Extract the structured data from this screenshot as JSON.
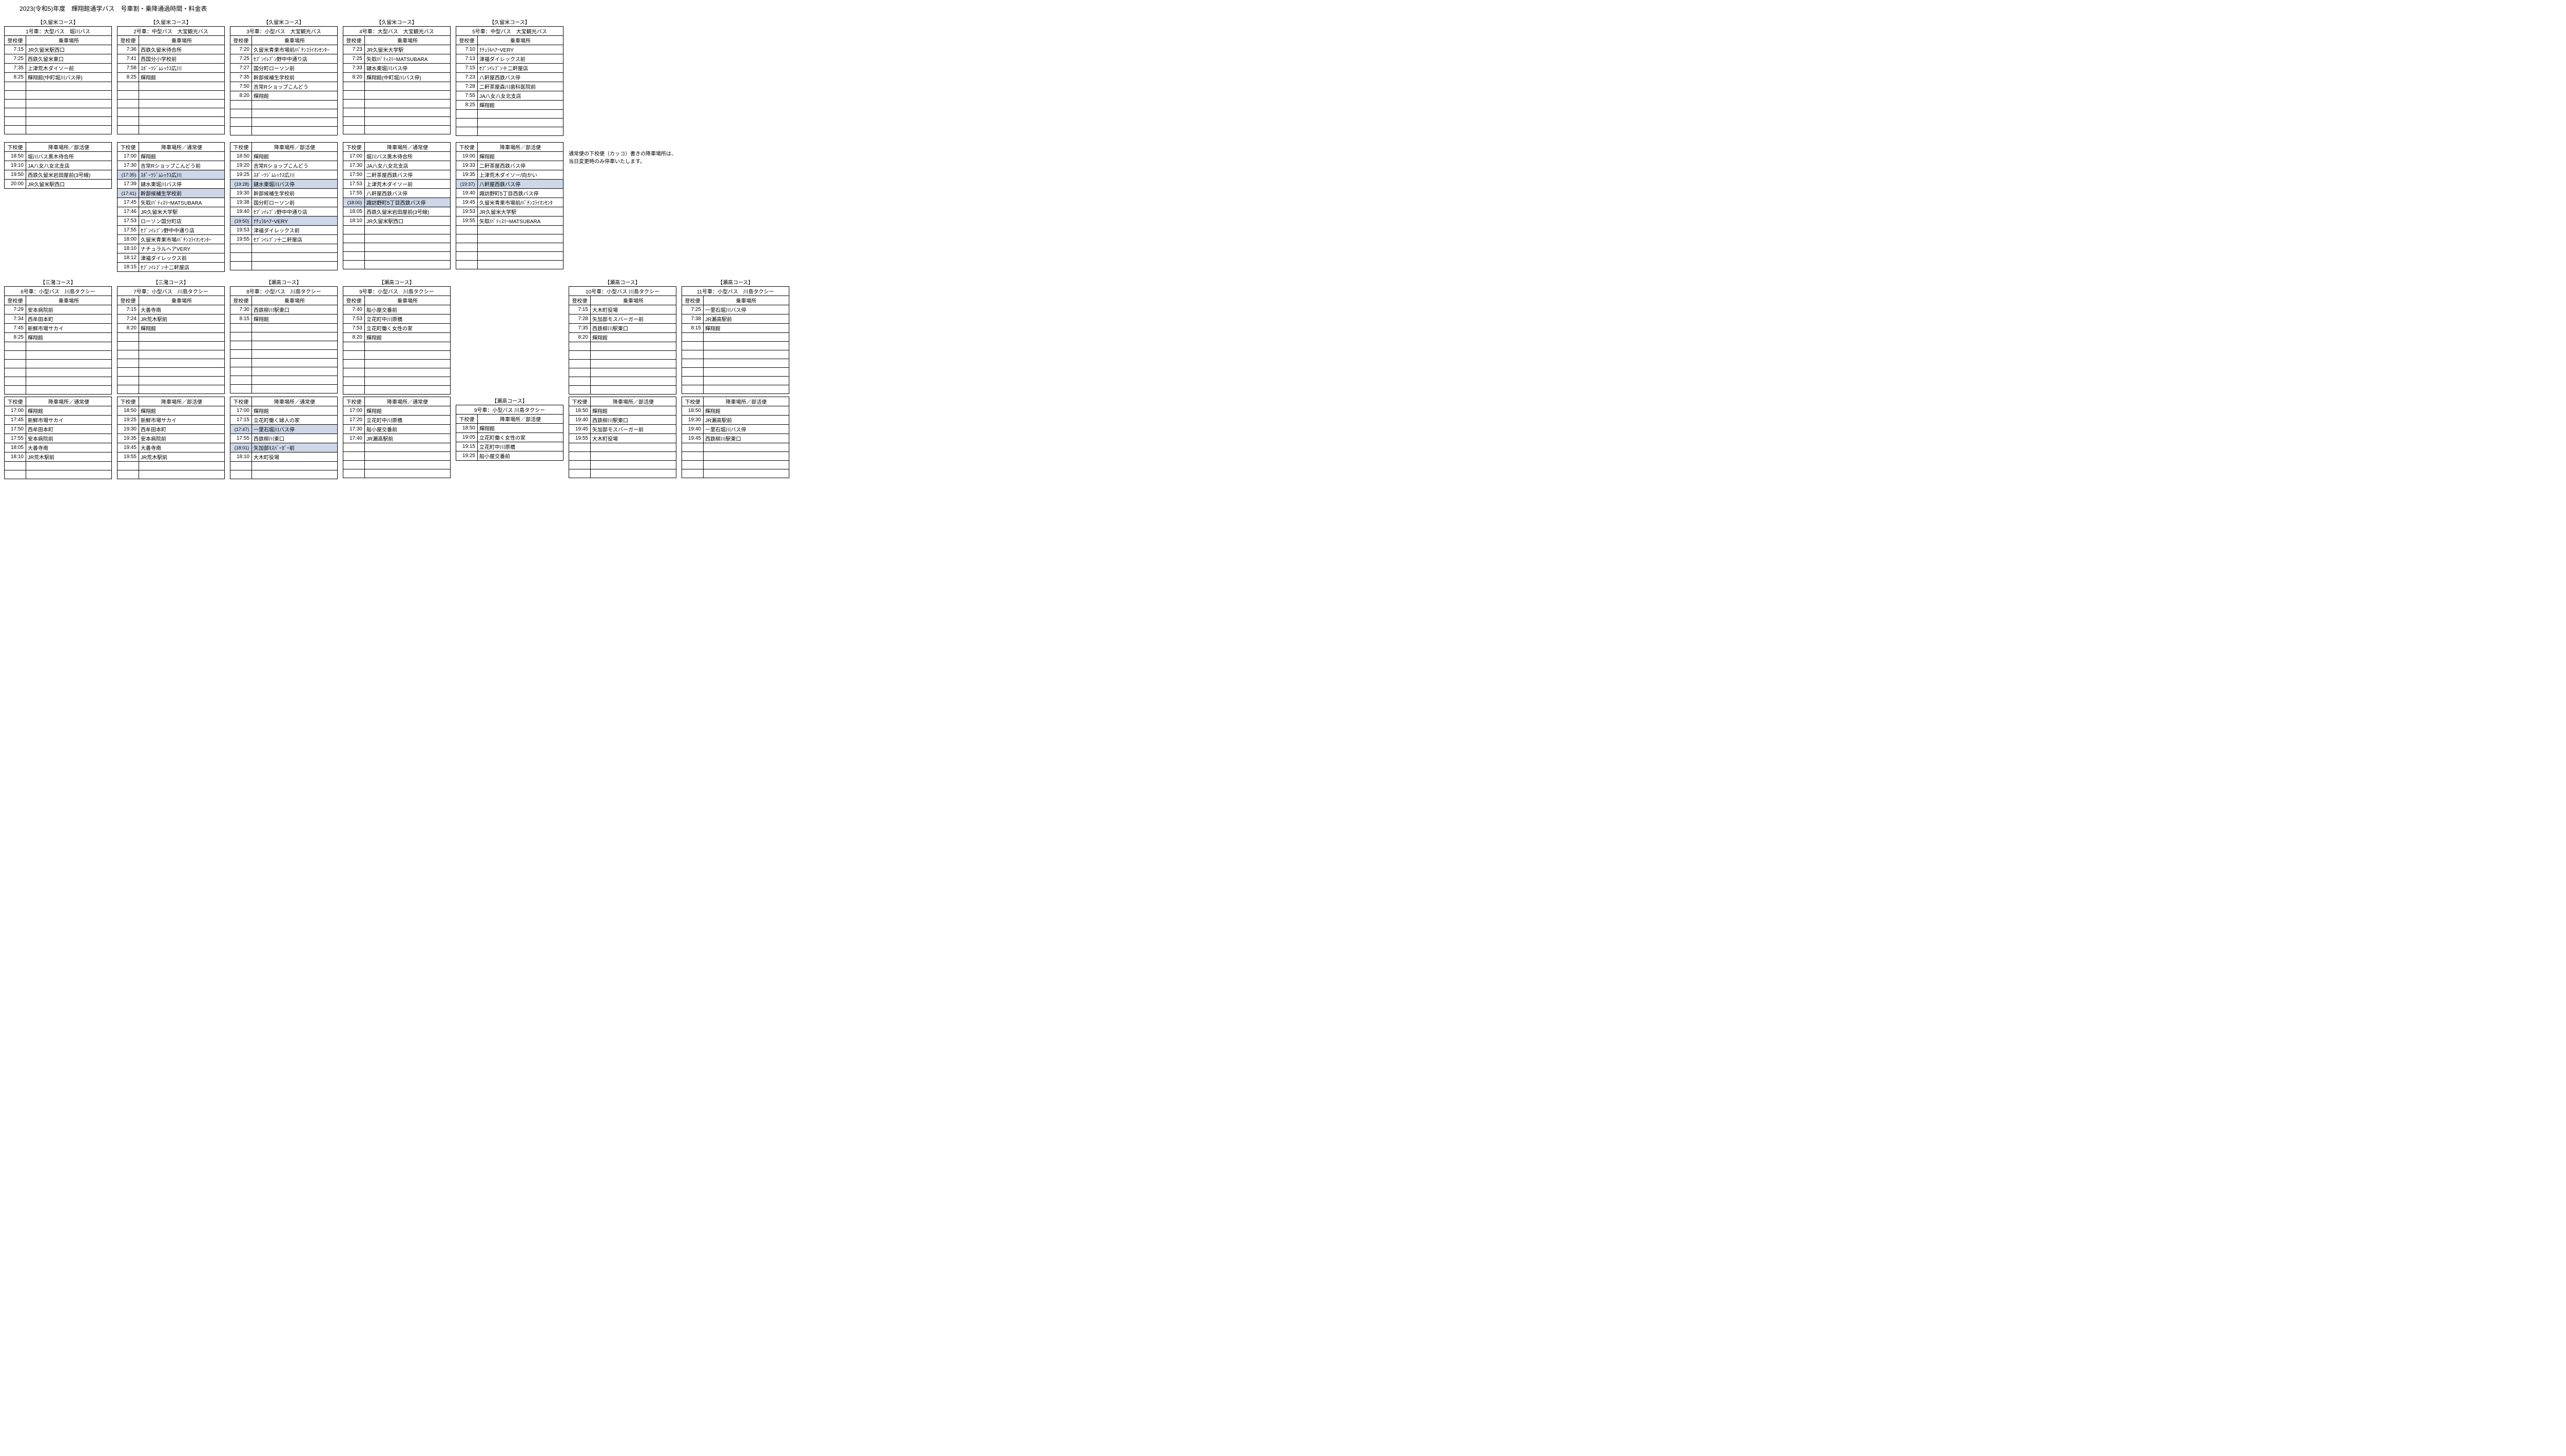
{
  "title": "2023(令和5)年度　輝翔館通学バス　号車割・乗降通過時間・料金表",
  "labels": {
    "boarding_service": "登校便",
    "boarding_place": "乗車場所",
    "alighting_service": "下校便",
    "alighting_normal": "降車場所／通常便",
    "alighting_club": "降車場所／部活便"
  },
  "notes": [
    "通常便の下校便（カッコ）書きの降車場所は、",
    "当日変更時のみ停車いたします。"
  ],
  "row1": [
    {
      "course": "【久留米コース】",
      "bus": "1号車：大型バス　堀川バス",
      "rows": [
        [
          "7:15",
          "JR久留米駅西口"
        ],
        [
          "7:25",
          "西鉄久留米東口"
        ],
        [
          "7:35",
          "上津荒木ダイソー前"
        ],
        [
          "8:25",
          "輝翔館(中町堀川バス停)"
        ]
      ],
      "min": 10
    },
    {
      "course": "【久留米コース】",
      "bus": "2号車：中型バス　大宝観光バス",
      "rows": [
        [
          "7:36",
          "西鉄久留米待合所"
        ],
        [
          "7:41",
          "西国分小学校前"
        ],
        [
          "7:58",
          "ｽﾎﾟｰﾂｼﾞﾑﾚｯｸｽ広川"
        ],
        [
          "8:25",
          "輝翔館"
        ]
      ],
      "min": 10
    },
    {
      "course": "【久留米コース】",
      "bus": "3号車：小型バス　大宝観光バス",
      "rows": [
        [
          "7:20",
          "久留米青果市場前/ﾊﾟﾁﾝｺﾗｲｵﾝｾﾝﾀｰ"
        ],
        [
          "7:25",
          "ｾﾌﾞﾝｲﾚﾌﾞﾝ野中中通り店"
        ],
        [
          "7:27",
          "国分町ローソン前"
        ],
        [
          "7:35",
          "幹部候補生学校前"
        ],
        [
          "7:50",
          "吉常Rショップこんどう"
        ],
        [
          "8:20",
          "輝翔館"
        ]
      ],
      "min": 10
    },
    {
      "course": "【久留米コース】",
      "bus": "4号車：大型バス　大宝観光バス",
      "rows": [
        [
          "7:23",
          "JR久留米大学駅"
        ],
        [
          "7:25",
          "矢取/ﾊﾟﾃｨｽﾘｰMATSUBARA"
        ],
        [
          "7:33",
          "鑓水東堀川バス停"
        ],
        [
          "8:20",
          "輝翔館(中町堀川バス停)"
        ]
      ],
      "min": 10
    },
    {
      "course": "【久留米コース】",
      "bus": "5号車：中型バス　大宝観光バス",
      "rows": [
        [
          "7:10",
          "ﾅﾁｭﾗﾙﾍｱｰVERY"
        ],
        [
          "7:13",
          "津福ダイレックス前"
        ],
        [
          "7:15",
          "ｾﾌﾞﾝｲﾚﾌﾞﾝ十二軒屋店"
        ],
        [
          "7:23",
          "八軒屋西鉄バス停"
        ],
        [
          "7:28",
          "二軒茶屋森川歯科医院前"
        ],
        [
          "7:55",
          "JA八女八女北支店"
        ],
        [
          "8:25",
          "輝翔館"
        ]
      ],
      "min": 10
    }
  ],
  "row2": [
    {
      "header_place": "alighting_club",
      "rows": [
        [
          "18:50",
          "堀川バス黒木待合所"
        ],
        [
          "19:10",
          "JA八女八女北支店"
        ],
        [
          "19:50",
          "西鉄久留米岩田屋前(3号線)"
        ],
        [
          "20:00",
          "JR久留米駅西口"
        ]
      ],
      "min": 4
    },
    {
      "header_place": "alighting_normal",
      "rows": [
        [
          "17:00",
          "輝翔館"
        ],
        [
          "17:30",
          "吉常Rショップこんどう前"
        ],
        [
          "(17:35)",
          "ｽﾎﾟｰﾂｼﾞﾑﾚｯｸｽ広川",
          "hl"
        ],
        [
          "17:39",
          "鑓水東堀川バス停"
        ],
        [
          "(17:41)",
          "幹部候補生学校前",
          "hl"
        ],
        [
          "17:45",
          "矢取/ﾊﾟﾃｨｽﾘｰMATSUBARA"
        ],
        [
          "17:46",
          "JR久留米大学駅"
        ],
        [
          "17:53",
          "ローソン国分町店"
        ],
        [
          "17:55",
          "ｾﾌﾞﾝｲﾚﾌﾞﾝ野中中通り店"
        ],
        [
          "18:00",
          "久留米青果市場/ﾊﾟﾁﾝｺﾗｲｵﾝｾﾝﾀｰ"
        ],
        [
          "18:10",
          "ナチュラルヘアVERY"
        ],
        [
          "18:12",
          "津福ダイレックス前"
        ],
        [
          "18:15",
          "ｾﾌﾞﾝｲﾚﾌﾞﾝ十二軒屋店"
        ]
      ],
      "min": 13
    },
    {
      "header_place": "alighting_club",
      "rows": [
        [
          "18:50",
          "輝翔館"
        ],
        [
          "19:20",
          "吉常Rショップこんどう"
        ],
        [
          "19:25",
          "ｽﾎﾟｰﾂｼﾞﾑﾚｯｸｽ広川"
        ],
        [
          "(19:28)",
          "鑓水東堀川バス停",
          "hl"
        ],
        [
          "19:30",
          "幹部候補生学校前"
        ],
        [
          "19:38",
          "国分町ローソン前"
        ],
        [
          "19:40",
          "ｾﾌﾞﾝｲﾚﾌﾞﾝ野中中通り店"
        ],
        [
          "(19:50)",
          "ﾅﾁｭﾗﾙﾍｱｰVERY",
          "hl"
        ],
        [
          "19:53",
          "津福ダイレックス前"
        ],
        [
          "19:55",
          "ｾﾌﾞﾝｲﾚﾌﾞﾝ十二軒屋店"
        ]
      ],
      "min": 13
    },
    {
      "header_place": "alighting_normal",
      "rows": [
        [
          "17:00",
          "堀川バス黒木待合所"
        ],
        [
          "17:30",
          "JA八女八女北支店"
        ],
        [
          "17:50",
          "二軒茶屋西鉄バス停"
        ],
        [
          "17:53",
          "上津荒木ダイソー前"
        ],
        [
          "17:55",
          "八軒屋西鉄バス停"
        ],
        [
          "(18:00)",
          "諏訪野町5丁目西鉄バス停",
          "hl"
        ],
        [
          "18:05",
          "西鉄久留米岩田屋前(3号線)"
        ],
        [
          "18:10",
          "JR久留米駅西口"
        ]
      ],
      "min": 13
    },
    {
      "header_place": "alighting_club",
      "rows": [
        [
          "19:00",
          "輝翔館"
        ],
        [
          "19:33",
          "二軒茶屋西鉄バス停"
        ],
        [
          "19:35",
          "上津荒木ダイソー/向かい"
        ],
        [
          "(19:37)",
          "八軒屋西鉄バス停",
          "hl"
        ],
        [
          "19:40",
          "諏訪野町5丁目西鉄バス停"
        ],
        [
          "19:45",
          "久留米青果市場前/ﾊﾟﾁﾝｺﾗｲｵﾝｾﾝﾀ"
        ],
        [
          "19:53",
          "JR久留米大学駅"
        ],
        [
          "19:55",
          "矢取/ﾊﾟﾃｨｽﾘｰMATSUBARA"
        ]
      ],
      "min": 13
    },
    {
      "note": true
    }
  ],
  "row3": [
    {
      "course": "【三潴コース】",
      "bus": "6号車：小型バス　川島タクシー",
      "rows": [
        [
          "7:29",
          "安本病院前"
        ],
        [
          "7:34",
          "西牟田本町"
        ],
        [
          "7:45",
          "新鮮市場サカイ"
        ],
        [
          "8:25",
          "輝翔館"
        ]
      ],
      "min": 10
    },
    {
      "course": "【三潴コース】",
      "bus": "7号車：小型バス　川島タクシー",
      "rows": [
        [
          "7:15",
          "大善寺南"
        ],
        [
          "7:24",
          "JR荒木駅前"
        ],
        [
          "8:20",
          "輝翔館"
        ]
      ],
      "min": 10
    },
    {
      "course": "【瀬高コース】",
      "bus": "8号車：小型バス　川島タクシー",
      "rows": [
        [
          "7:30",
          "西鉄柳川駅東口"
        ],
        [
          "8:15",
          "輝翔館"
        ]
      ],
      "min": 10
    },
    {
      "course": "【瀬高コース】",
      "bus": "9号車：小型バス　川島タクシー",
      "rows": [
        [
          "7:40",
          "船小屋交番前"
        ],
        [
          "7:53",
          "立花町中川原橋"
        ],
        [
          "7:53",
          "立花町働く女性の家"
        ],
        [
          "8:20",
          "輝翔館"
        ]
      ],
      "min": 10
    },
    null,
    {
      "course": "【瀬高コース】",
      "bus": "10号車：小型バス 川島タクシー",
      "rows": [
        [
          "7:15",
          "大木町役場"
        ],
        [
          "7:28",
          "矢加部モスバーガー前"
        ],
        [
          "7:35",
          "西鉄柳川駅東口"
        ],
        [
          "8:20",
          "輝翔館"
        ]
      ],
      "min": 10
    },
    {
      "course": "【瀬高コース】",
      "bus": "11号車：小型バス　川島タクシー",
      "rows": [
        [
          "7:25",
          "一里石堀川バス停"
        ],
        [
          "7:38",
          "JR瀬高駅前"
        ],
        [
          "8:15",
          "輝翔館"
        ]
      ],
      "min": 10
    }
  ],
  "row4": [
    {
      "header_place": "alighting_normal",
      "rows": [
        [
          "17:00",
          "輝翔館"
        ],
        [
          "17:45",
          "新鮮市場サカイ"
        ],
        [
          "17:50",
          "西牟田本町"
        ],
        [
          "17:55",
          "安本病院前"
        ],
        [
          "18:05",
          "大善寺南"
        ],
        [
          "18:10",
          "JR荒木駅前"
        ]
      ],
      "min": 8
    },
    {
      "header_place": "alighting_club",
      "rows": [
        [
          "18:50",
          "輝翔館"
        ],
        [
          "19:25",
          "新鮮市場サカイ"
        ],
        [
          "19:30",
          "西牟田本町"
        ],
        [
          "19:35",
          "安本病院前"
        ],
        [
          "19:45",
          "大善寺南"
        ],
        [
          "19:55",
          "JR荒木駅前"
        ]
      ],
      "min": 8
    },
    {
      "header_place": "alighting_normal",
      "rows": [
        [
          "17:00",
          "輝翔館"
        ],
        [
          "17:15",
          "立花町働く婦人の家"
        ],
        [
          "(17:47)",
          "一里石堀川バス停",
          "hl"
        ],
        [
          "17:55",
          "西鉄柳川東口"
        ],
        [
          "(18:01)",
          "矢加部ﾓｽﾊﾞｰｶﾞｰ前",
          "hl"
        ],
        [
          "18:10",
          "大木町役場"
        ]
      ],
      "min": 8
    },
    {
      "header_place": "alighting_normal",
      "rows": [
        [
          "17:00",
          "輝翔館"
        ],
        [
          "17:20",
          "立花町中川原橋"
        ],
        [
          "17:30",
          "船小屋交番前"
        ],
        [
          "17:40",
          "JR瀬高駅前"
        ]
      ],
      "min": 8
    },
    {
      "course": "【瀬高コース】",
      "bus": "9号車：小型バス 川島タクシー",
      "header_place": "alighting_club",
      "rows": [
        [
          "18:50",
          "輝翔館"
        ],
        [
          "19:05",
          "立花町働く女性の家"
        ],
        [
          "19:15",
          "立花町中川原橋"
        ],
        [
          "19:25",
          "船小屋交番前"
        ]
      ],
      "min": 4
    },
    {
      "header_place": "alighting_club",
      "rows": [
        [
          "18:50",
          "輝翔館"
        ],
        [
          "19:40",
          "西鉄柳川駅東口"
        ],
        [
          "19:45",
          "矢加部モスバーガー前"
        ],
        [
          "19:55",
          "大木町役場"
        ]
      ],
      "min": 8
    },
    {
      "header_place": "alighting_club",
      "rows": [
        [
          "18:50",
          "輝翔館"
        ],
        [
          "19:30",
          "JR瀬高駅前"
        ],
        [
          "19:40",
          "一里石堀川バス停"
        ],
        [
          "19:45",
          "西鉄柳川駅東口"
        ]
      ],
      "min": 8
    }
  ]
}
